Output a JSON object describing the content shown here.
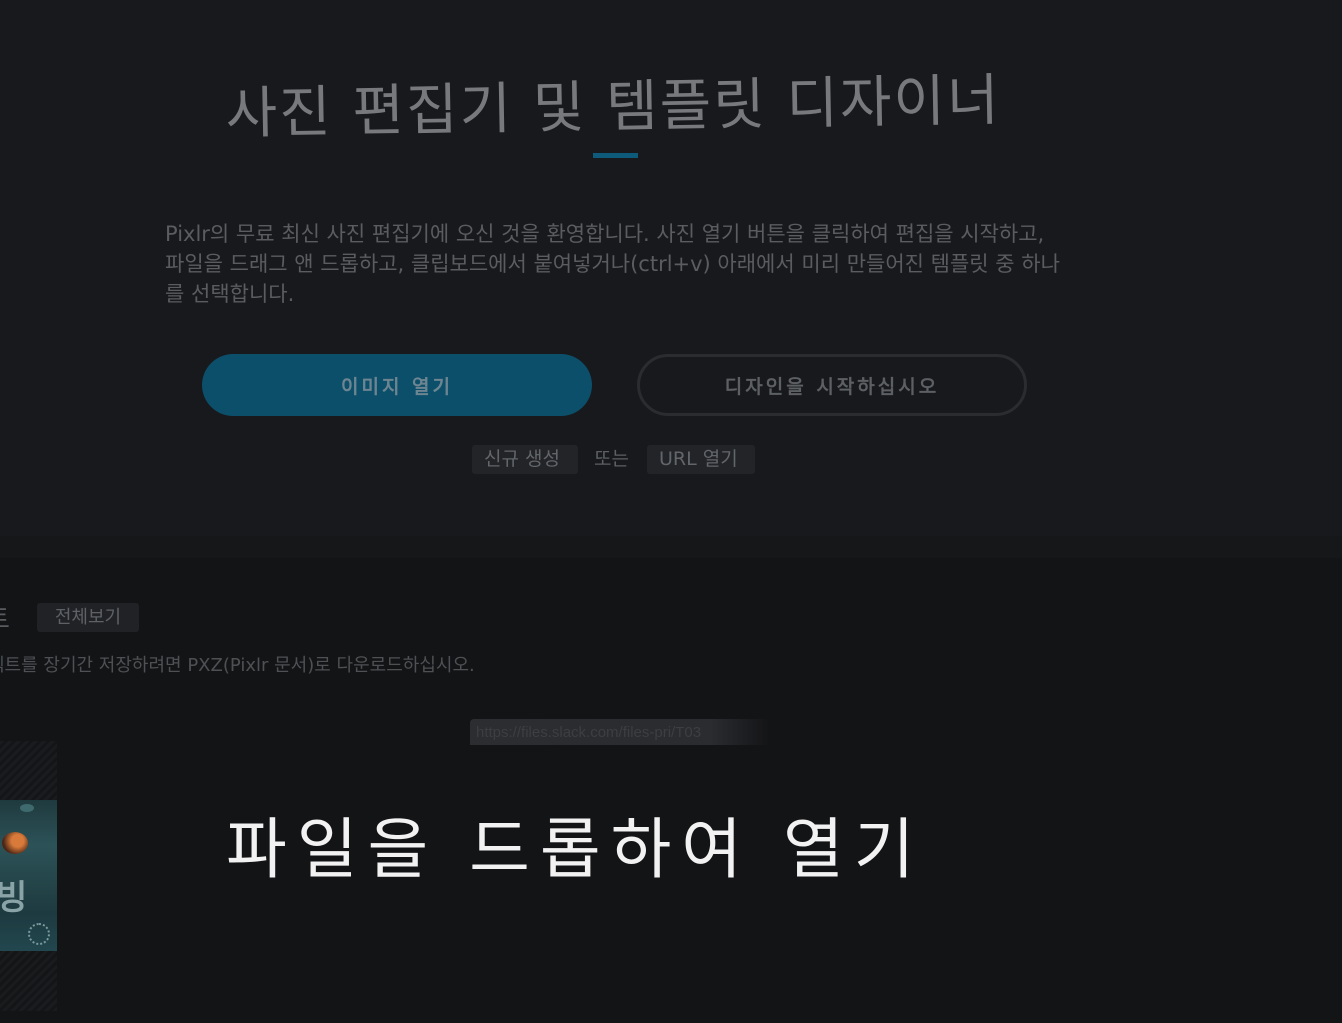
{
  "hero": {
    "title": "사진 편집기 및 템플릿 디자이너",
    "intro": "Pixlr의 무료 최신 사진 편집기에 오신 것을 환영합니다. 사진 열기 버튼을 클릭하여 편집을 시작하고, 파일을 드래그 앤 드롭하고, 클립보드에서 붙여넣거나(ctrl+v) 아래에서 미리 만들어진 템플릿 중 하나를 선택합니다.",
    "open_image_label": "이미지 열기",
    "start_design_label": "디자인을 시작하십시오",
    "new_label": "신규 생성",
    "or_label": "또는",
    "open_url_label": "URL 열기"
  },
  "projects": {
    "heading": "트",
    "view_all_label": "전체보기",
    "note": "젝트를 장기간 저장하려면 PXZ(Pixlr 문서)로 다운로드하십시오.",
    "thumbnail_text": "빙"
  },
  "drag": {
    "tooltip_url": "https://files.slack.com/files-pri/T03",
    "drop_text": "파일을 드롭하여 열기"
  },
  "colors": {
    "accent": "#0c4f6b",
    "underline": "#0d5a7a",
    "background_top": "#18191c",
    "background_bottom": "#131416",
    "drop_text": "#f2f2f2"
  }
}
